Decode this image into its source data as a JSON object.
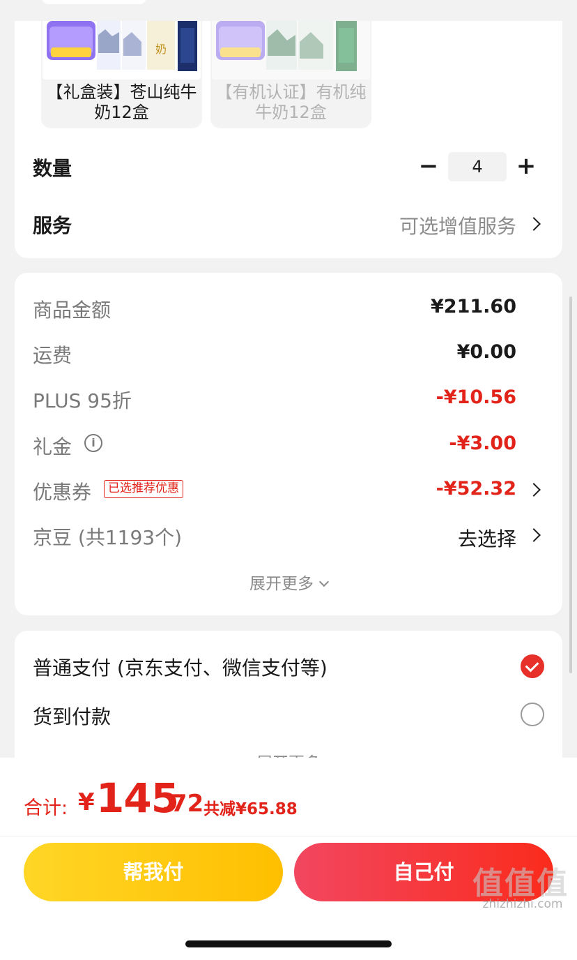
{
  "variants": [
    {
      "name": "【礼盒装】苍山纯牛奶12盒",
      "state": "selected"
    },
    {
      "name": "【有机认证】有机纯牛奶12盒",
      "state": "disabled"
    }
  ],
  "quantity": {
    "label": "数量",
    "minus": "−",
    "value": "4",
    "plus": "+"
  },
  "service": {
    "label": "服务",
    "value": "可选增值服务"
  },
  "price_rows": {
    "goods": {
      "label": "商品金额",
      "value": "¥211.60"
    },
    "shipping": {
      "label": "运费",
      "value": "¥0.00"
    },
    "plus": {
      "label": "PLUS 95折",
      "value": "-¥10.56"
    },
    "gift": {
      "label": "礼金",
      "info_icon": "i",
      "value": "-¥3.00"
    },
    "coupon": {
      "label": "优惠券",
      "tag": "已选推荐优惠",
      "value": "-¥52.32"
    },
    "beans": {
      "label": "京豆 (共1193个)",
      "value": "去选择"
    }
  },
  "expand_more": "展开更多",
  "payment": {
    "normal": "普通支付 (京东支付、微信支付等)",
    "cod": "货到付款",
    "expand_more": "展开更多"
  },
  "total": {
    "label": "合计:",
    "currency": "¥",
    "integer": "145",
    "decimal": ".72",
    "saving": "共减¥65.88"
  },
  "buttons": {
    "help_pay": "帮我付",
    "self_pay": "自己付"
  },
  "watermark": {
    "text": "值值值",
    "domain": "zhizhizhi.com"
  },
  "colors": {
    "accent_red": "#e2231a",
    "help_button": "#ffc800",
    "self_button": "#f5302a"
  }
}
